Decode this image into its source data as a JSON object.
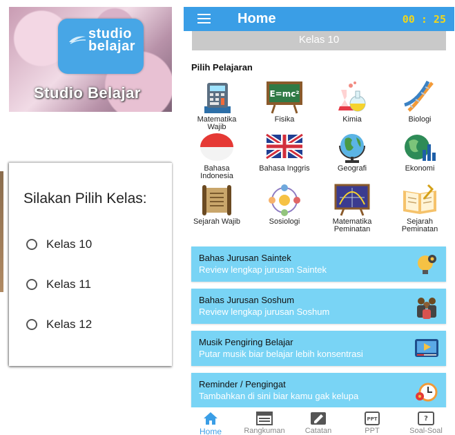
{
  "splash": {
    "logo_line1": "studio",
    "logo_line2": "belajar",
    "caption": "Studio Belajar"
  },
  "class_dialog": {
    "title": "Silakan Pilih Kelas:",
    "options": [
      "Kelas 10",
      "Kelas 11",
      "Kelas 12"
    ]
  },
  "app": {
    "title": "Home",
    "timer": "00 : 25",
    "selected_class": "Kelas 10",
    "section_title": "Pilih Pelajaran",
    "subjects": [
      {
        "line1": "Matematika",
        "line2": "Wajib",
        "icon": "calculator-icon"
      },
      {
        "line1": "Fisika",
        "line2": "",
        "icon": "blackboard-emc2-icon"
      },
      {
        "line1": "Kimia",
        "line2": "",
        "icon": "flasks-icon"
      },
      {
        "line1": "Biologi",
        "line2": "",
        "icon": "dna-icon"
      },
      {
        "line1": "Bahasa",
        "line2": "Indonesia",
        "icon": "indonesia-flag-icon"
      },
      {
        "line1": "Bahasa Inggris",
        "line2": "",
        "icon": "uk-flag-icon"
      },
      {
        "line1": "Geografi",
        "line2": "",
        "icon": "globe-icon"
      },
      {
        "line1": "Ekonomi",
        "line2": "",
        "icon": "globe-chart-icon"
      },
      {
        "line1": "Sejarah Wajib",
        "line2": "",
        "icon": "scroll-icon"
      },
      {
        "line1": "Sosiologi",
        "line2": "",
        "icon": "people-network-icon"
      },
      {
        "line1": "Matematika",
        "line2": "Peminatan",
        "icon": "graph-board-icon"
      },
      {
        "line1": "Sejarah",
        "line2": "Peminatan",
        "icon": "open-book-icon"
      }
    ],
    "cards": [
      {
        "title": "Bahas Jurusan Saintek",
        "subtitle": "Review lengkap jurusan Saintek",
        "icon": "lightbulb-gear-icon"
      },
      {
        "title": "Bahas Jurusan Soshum",
        "subtitle": "Review lengkap jurusan Soshum",
        "icon": "group-people-icon"
      },
      {
        "title": "Musik Pengiring Belajar",
        "subtitle": "Putar musik biar belajar lebih konsentrasi",
        "icon": "video-player-icon"
      },
      {
        "title": "Reminder / Pengingat",
        "subtitle": "Tambahkan di sini biar kamu gak kelupa",
        "icon": "alarm-clock-icon"
      }
    ],
    "nav": [
      {
        "label": "Home",
        "icon": "home-icon",
        "active": true
      },
      {
        "label": "Rangkuman",
        "icon": "newspaper-icon",
        "active": false
      },
      {
        "label": "Catatan",
        "icon": "note-icon",
        "active": false
      },
      {
        "label": "PPT",
        "icon": "ppt-icon",
        "active": false
      },
      {
        "label": "Soal-Soal",
        "icon": "quiz-icon",
        "active": false
      }
    ],
    "colors": {
      "topbar": "#3a9ee6",
      "timer": "#f1d61a",
      "card": "#79d4f5",
      "active_nav": "#3a9ee6"
    }
  }
}
